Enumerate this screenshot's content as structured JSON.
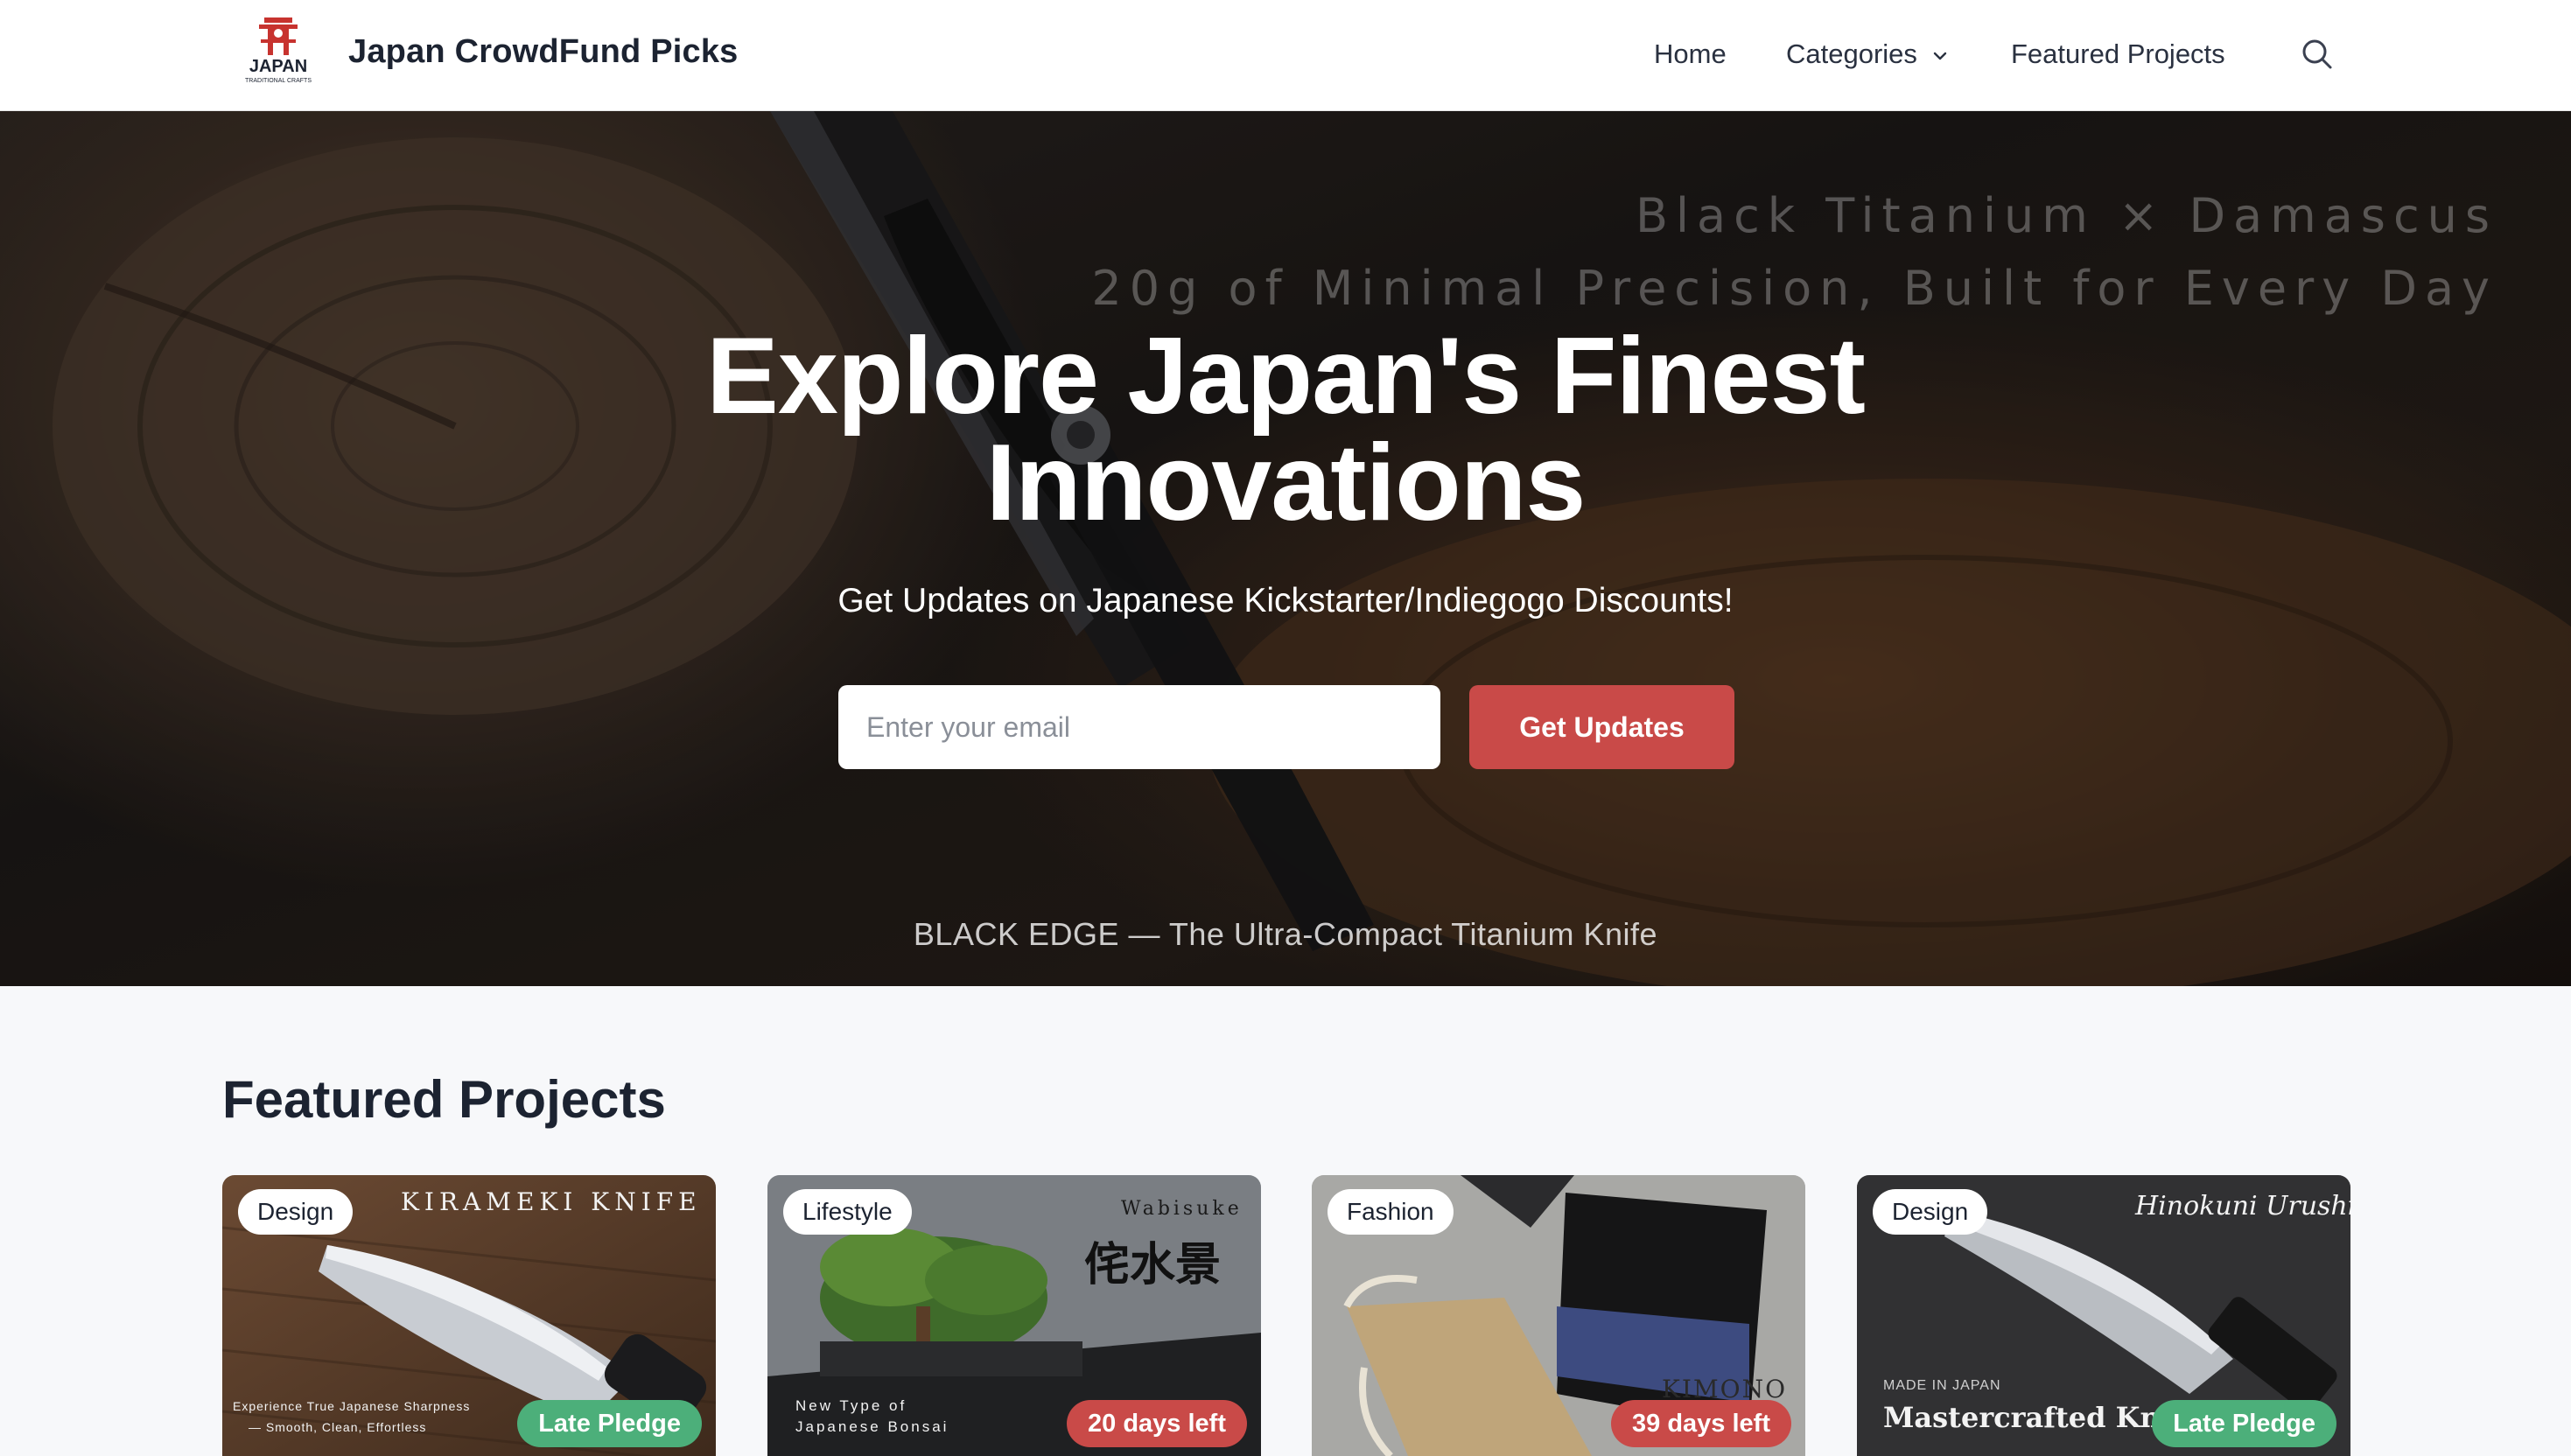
{
  "header": {
    "logo_text": "JAPAN",
    "logo_subtext": "TRADITIONAL CRAFTS",
    "site_title": "Japan CrowdFund Picks",
    "nav": {
      "home": "Home",
      "categories": "Categories",
      "featured": "Featured Projects"
    }
  },
  "hero": {
    "overlay_line_1": "Black Titanium × Damascus",
    "overlay_line_2": "20g of Minimal Precision, Built for Every Day",
    "title_line_1": "Explore Japan's Finest",
    "title_line_2": "Innovations",
    "subtitle": "Get Updates on Japanese Kickstarter/Indiegogo Discounts!",
    "email_placeholder": "Enter your email",
    "button_label": "Get Updates",
    "caption": "BLACK EDGE — The Ultra-Compact Titanium Knife"
  },
  "featured": {
    "title": "Featured Projects",
    "cards": [
      {
        "category": "Design",
        "status": "Late Pledge",
        "heading": "KIRAMEKI KNIFE",
        "line_1": "Experience True Japanese Sharpness",
        "line_2": "— Smooth, Clean, Effortless"
      },
      {
        "category": "Lifestyle",
        "status": "20 days left",
        "heading": "Wabisuke",
        "kanji": "侘水景",
        "line_1": "New Type of",
        "line_2": "Japanese Bonsai"
      },
      {
        "category": "Fashion",
        "status": "39 days left",
        "heading": "KIMONO"
      },
      {
        "category": "Design",
        "status": "Late Pledge",
        "heading": "Hinokuni Urushi",
        "line_1": "MADE IN JAPAN",
        "line_2": "Mastercrafted Knife"
      }
    ]
  },
  "colors": {
    "accent": "#c94a48",
    "late_pledge": "#4caf7a",
    "text_dark": "#1c2331"
  },
  "icons": {
    "search": "search-icon",
    "categories_chevron": "chevron-down-icon"
  }
}
